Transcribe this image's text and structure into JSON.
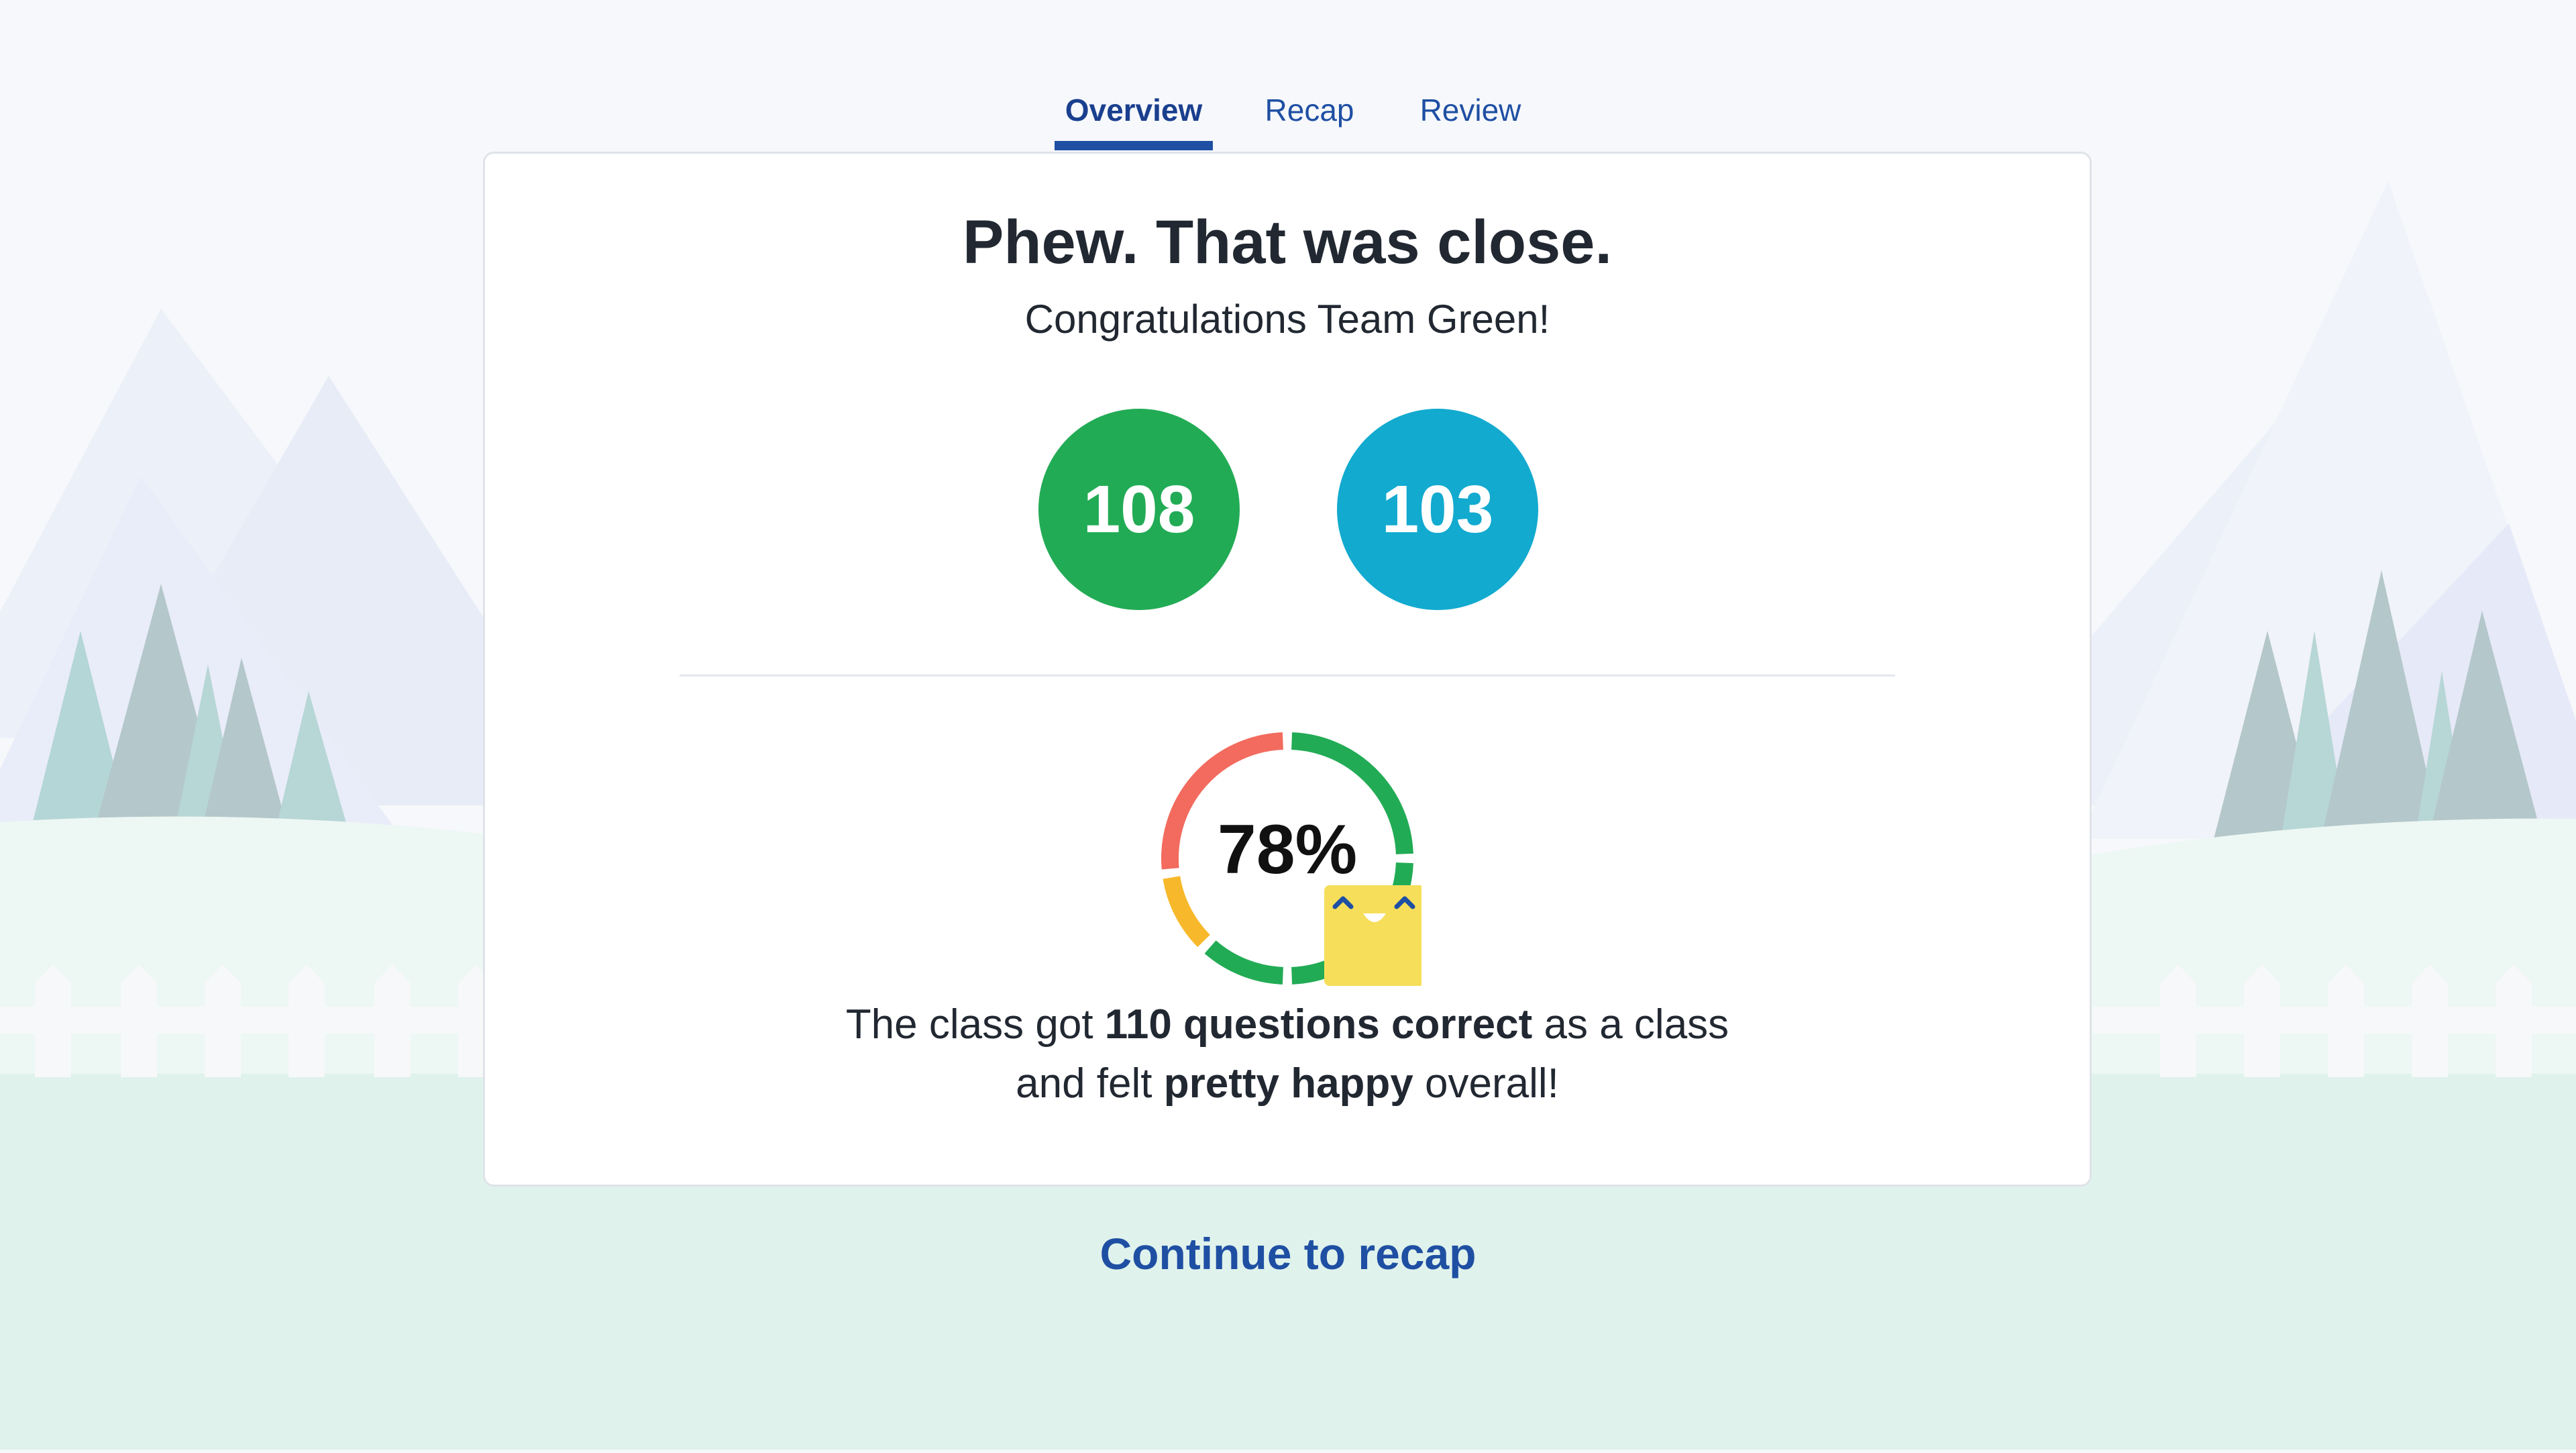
{
  "tabs": [
    {
      "label": "Overview",
      "active": true
    },
    {
      "label": "Recap",
      "active": false
    },
    {
      "label": "Review",
      "active": false
    }
  ],
  "headline": "Phew. That was close.",
  "subhead": "Congratulations Team Green!",
  "scores": [
    {
      "value": "108",
      "color": "#22ab55"
    },
    {
      "value": "103",
      "color": "#12aacf"
    }
  ],
  "result": {
    "percent_label": "78%",
    "percent_value": 78,
    "line1_pre": "The class got ",
    "line1_bold": "110 questions correct",
    "line1_post": " as a class",
    "line2_pre": "and felt ",
    "line2_bold": "pretty happy",
    "line2_post": " overall!"
  },
  "donut_segments": [
    {
      "color": "#22ab55",
      "fraction": 0.25
    },
    {
      "color": "#22ab55",
      "fraction": 0.25
    },
    {
      "color": "#22ab55",
      "fraction": 0.12
    },
    {
      "color": "#f7b92b",
      "fraction": 0.11
    },
    {
      "color": "#f26b5e",
      "fraction": 0.27
    }
  ],
  "continue_label": "Continue to recap",
  "colors": {
    "brand_blue": "#1f4fa3",
    "happy_face": "#f7de5a"
  }
}
